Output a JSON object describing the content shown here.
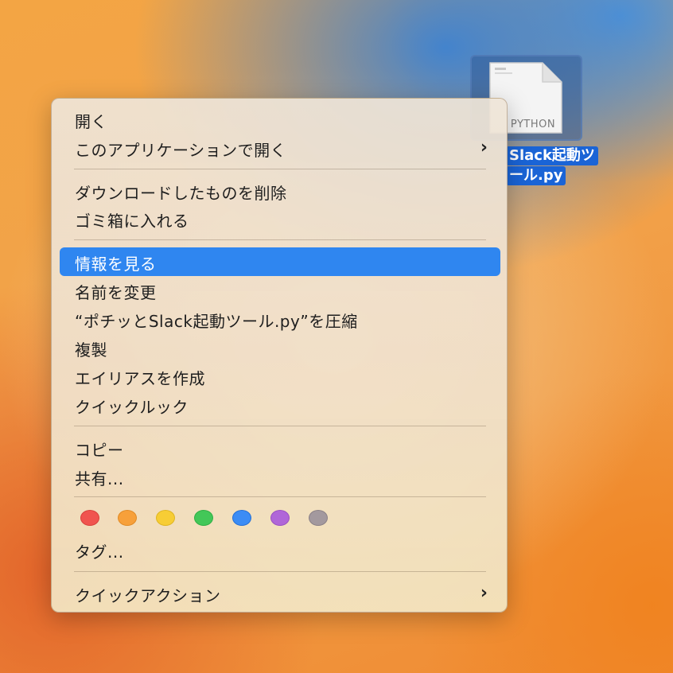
{
  "desktop_file": {
    "icon_label": "PYTHON",
    "name_lines": [
      "Slack起動ツ",
      "ール.py"
    ]
  },
  "context_menu": {
    "items": [
      {
        "label": "開く",
        "submenu": false
      },
      {
        "label": "このアプリケーションで開く",
        "submenu": true
      },
      {
        "label": "ダウンロードしたものを削除",
        "submenu": false
      },
      {
        "label": "ゴミ箱に入れる",
        "submenu": false
      },
      {
        "label": "情報を見る",
        "submenu": false,
        "highlighted": true
      },
      {
        "label": "名前を変更",
        "submenu": false
      },
      {
        "label": "“ポチッとSlack起動ツール.py”を圧縮",
        "submenu": false
      },
      {
        "label": "複製",
        "submenu": false
      },
      {
        "label": "エイリアスを作成",
        "submenu": false
      },
      {
        "label": "クイックルック",
        "submenu": false
      },
      {
        "label": "コピー",
        "submenu": false
      },
      {
        "label": "共有...",
        "submenu": false
      },
      {
        "label": "タグ...",
        "submenu": false
      },
      {
        "label": "クイックアクション",
        "submenu": true
      }
    ],
    "submenu_glyph": "›",
    "tag_colors": [
      {
        "name": "red",
        "fill": "#f0544f",
        "border": "#d8403b"
      },
      {
        "name": "orange",
        "fill": "#f7a03a",
        "border": "#e08a25"
      },
      {
        "name": "yellow",
        "fill": "#f7cd35",
        "border": "#dfb520"
      },
      {
        "name": "green",
        "fill": "#43c758",
        "border": "#2fae44"
      },
      {
        "name": "blue",
        "fill": "#3b8cf5",
        "border": "#236fd6"
      },
      {
        "name": "purple",
        "fill": "#b066d8",
        "border": "#9a50c2"
      },
      {
        "name": "gray",
        "fill": "#a3999e",
        "border": "#8a8086"
      }
    ],
    "accent_color": "#2f86f0"
  }
}
